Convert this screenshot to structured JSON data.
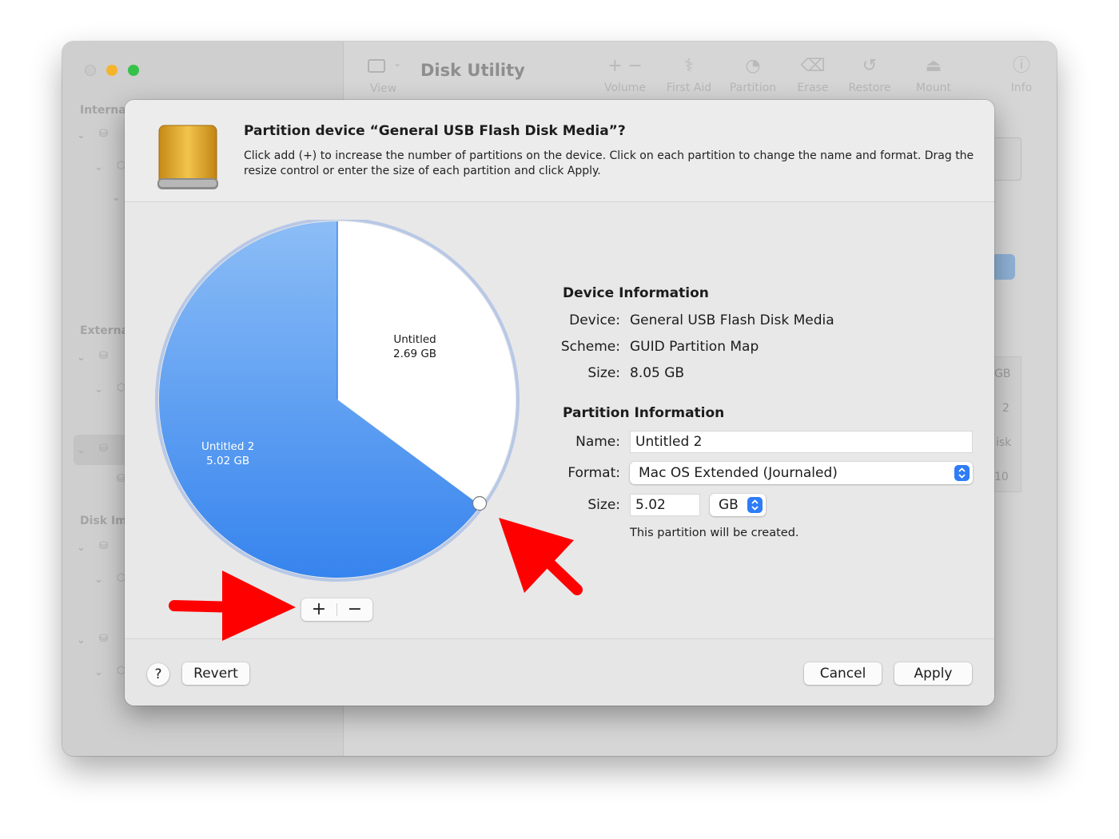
{
  "bg_window": {
    "title": "Disk Utility",
    "view_label": "View",
    "toolbar": [
      {
        "label": "Volume",
        "icon": "plus-minus-icon"
      },
      {
        "label": "First Aid",
        "icon": "stethoscope-icon"
      },
      {
        "label": "Partition",
        "icon": "partition-icon"
      },
      {
        "label": "Erase",
        "icon": "erase-icon"
      },
      {
        "label": "Restore",
        "icon": "restore-icon"
      },
      {
        "label": "Mount",
        "icon": "mount-icon"
      },
      {
        "label": "Info",
        "icon": "info-icon"
      }
    ],
    "sidebar": {
      "internal_label": "Interna",
      "external_label": "Externa",
      "disk_images_label": "Disk Im"
    },
    "right_fragments": [
      "GB",
      "2",
      "isk",
      "10"
    ]
  },
  "sheet": {
    "title": "Partition device “General USB Flash Disk Media”?",
    "description": "Click add (+) to increase the number of partitions on the device. Click on each partition to change the name and format. Drag the resize control or enter the size of each partition and click Apply.",
    "pie": {
      "free_name": "Untitled",
      "free_size": "2.69 GB",
      "part_name": "Untitled 2",
      "part_size": "5.02 GB",
      "colors": {
        "partition": "#4a90ee",
        "free": "#ffffff",
        "ring": "#b8c8e6"
      }
    },
    "segment": {
      "add": "+",
      "remove": "−"
    },
    "device_info": {
      "heading": "Device Information",
      "device_key": "Device:",
      "device_value": "General USB Flash Disk Media",
      "scheme_key": "Scheme:",
      "scheme_value": "GUID Partition Map",
      "size_key": "Size:",
      "size_value": "8.05 GB"
    },
    "partition_info": {
      "heading": "Partition Information",
      "name_key": "Name:",
      "name_value": "Untitled 2",
      "format_key": "Format:",
      "format_value": "Mac OS Extended (Journaled)",
      "size_key": "Size:",
      "size_value": "5.02",
      "unit_value": "GB",
      "note": "This partition will be created."
    },
    "footer": {
      "help": "?",
      "revert": "Revert",
      "cancel": "Cancel",
      "apply": "Apply"
    }
  },
  "annotation_color": "#ff0000"
}
